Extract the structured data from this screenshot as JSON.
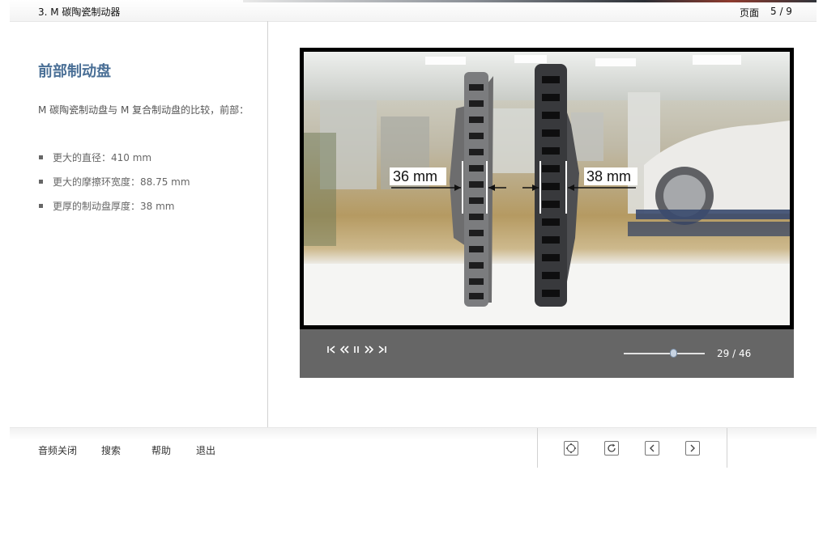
{
  "header": {
    "chapter_title": "3. M 碳陶瓷制动器",
    "page_label": "页面",
    "page_number": "5 / 9"
  },
  "content": {
    "title": "前部制动盘",
    "description": "M 碳陶瓷制动盘与 M 复合制动盘的比较，前部：",
    "bullets": [
      "更大的直径：410 mm",
      "更大的摩擦环宽度：88.75 mm",
      "更厚的制动盘厚度：38 mm"
    ]
  },
  "video": {
    "label_left": "36 mm",
    "label_right": "38 mm",
    "controls": {
      "first_icon": "skip-to-start-icon",
      "rewind_icon": "rewind-icon",
      "pause_icon": "pause-icon",
      "forward_icon": "fast-forward-icon",
      "last_icon": "skip-to-end-icon"
    },
    "frame_counter": "29 / 46",
    "progress_fraction": 0.63
  },
  "footer": {
    "links": {
      "audio_off": "音频关闭",
      "search": "搜索",
      "help": "帮助",
      "exit": "退出"
    },
    "nav_icons": [
      "overview-icon",
      "reload-icon",
      "previous-icon",
      "next-icon"
    ]
  }
}
